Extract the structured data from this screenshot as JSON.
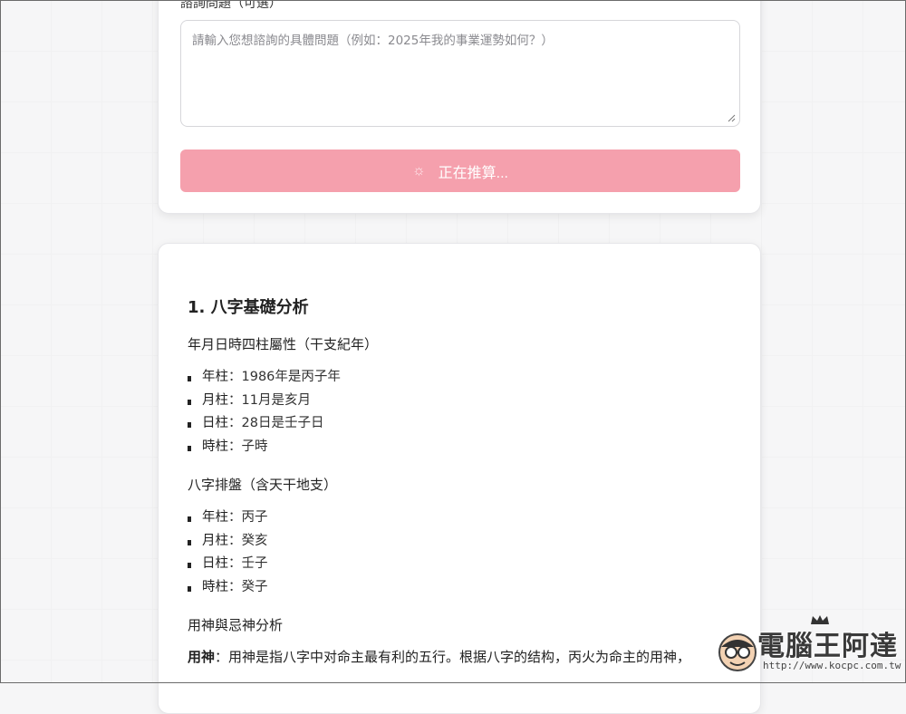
{
  "form": {
    "question_label_partial": "諮詢問題（可選）",
    "question_placeholder": "請輸入您想諮詢的具體問題（例如：2025年我的事業運勢如何？）",
    "submit_label": "正在推算...",
    "spinner_glyph": "☼"
  },
  "result": {
    "section_title": "1. 八字基礎分析",
    "pillars_attr": {
      "title": "年月日時四柱屬性（干支紀年）",
      "items": [
        {
          "key": "年柱",
          "value": "1986年是丙子年"
        },
        {
          "key": "月柱",
          "value": "11月是亥月"
        },
        {
          "key": "日柱",
          "value": "28日是壬子日"
        },
        {
          "key": "時柱",
          "value": "子時"
        }
      ]
    },
    "bazi_chart": {
      "title": "八字排盤（含天干地支）",
      "items": [
        {
          "key": "年柱",
          "value": "丙子"
        },
        {
          "key": "月柱",
          "value": "癸亥"
        },
        {
          "key": "日柱",
          "value": "壬子"
        },
        {
          "key": "時柱",
          "value": "癸子"
        }
      ]
    },
    "yongshen": {
      "title": "用神與忌神分析",
      "para_key": "用神",
      "para_text": "用神是指八字中对命主最有利的五行。根据八字的结构，丙火为命主的用神，"
    }
  },
  "watermark": {
    "brand": "電腦王阿達",
    "url": "http://www.kocpc.com.tw"
  },
  "colors": {
    "button_pink": "#f5a0ad",
    "card_bg": "#ffffff",
    "page_bg": "#f6f6f7"
  }
}
